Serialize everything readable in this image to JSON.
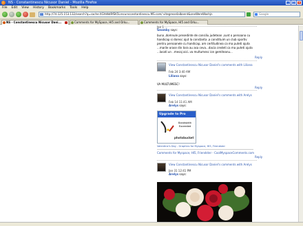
{
  "window": {
    "title": "NS - Constantinescu Nicusor Daniel - Mozilla Firefox",
    "buttons": [
      "_",
      "□",
      "x"
    ]
  },
  "menu": [
    "File",
    "Edit",
    "View",
    "History",
    "Bookmarks",
    "Tools",
    "Help"
  ],
  "nav": {
    "url": "http://74.125.153.132/search?q=cache:XGYeNdRfEK5Lrecursconstantinescu.MS.com/ vitegrese4albannt&oneWereWashjn",
    "search_placeholder": "Google"
  },
  "tabs": [
    {
      "label": "NS - Constantinescu Nicusor Dani..."
    },
    {
      "label": "Comments for MySpace, HI5 and Orku..."
    },
    {
      "label": "Comments for MySpace, HI5 and Orku..."
    }
  ],
  "page": {
    "top_date": "Jan 1 ...",
    "c1": {
      "author": "Geamby",
      "says": "says:",
      "lines": [
        "buna ,domnule presedinte de consiliu judetean ,sunt o persoana cu",
        "handicap si doresc ajut la constanta ,a constituim un club sportiv",
        "pentru persoanele cu handicap, am certitudinea ca ma puteti ajuta",
        "...marile orase din tara au asa ceva...dacia credeti ca ma puteti ajuta",
        "...lasati un  ..mesaj aici..va multumesc ion gemiteanu..."
      ],
      "reply": "Reply"
    },
    "c2": {
      "head": "View Constantinescu Nicusor Daniel's comments with Liliana",
      "date": "Feb 24 3:40 AM",
      "author": "Liliana",
      "says": "says:",
      "text": "VA MULTUMESC!",
      "reply": "Reply"
    },
    "c3": {
      "head": "View Constantinescu Nicusor Daniel's comments with Arelys",
      "date": "Feb 14 11:41 AM",
      "author": "Arelys",
      "says": "says:",
      "banner_title": "Upgrade to Pro today!",
      "bandwidth": "Bandwidth",
      "exceeded": "Exceeded",
      "pb_logo": "photobucket",
      "caption": "Valentine's Day - Graphics for Myspace, HI5, Friendster",
      "link": "Comments for Myspace, HI5, Friendster - CoolMyspaceComments.com",
      "reply": "Reply"
    },
    "c4": {
      "head": "View Constantinescu Nicusor Daniel's comments with Arelys",
      "date": "Jan 31 12:41 PM",
      "author": "Arelys",
      "says": "says:"
    }
  },
  "colors": {
    "titlebar": "#2a5fc9",
    "link": "#2a56b0",
    "upgrade_bar": "#2a5fc9"
  }
}
